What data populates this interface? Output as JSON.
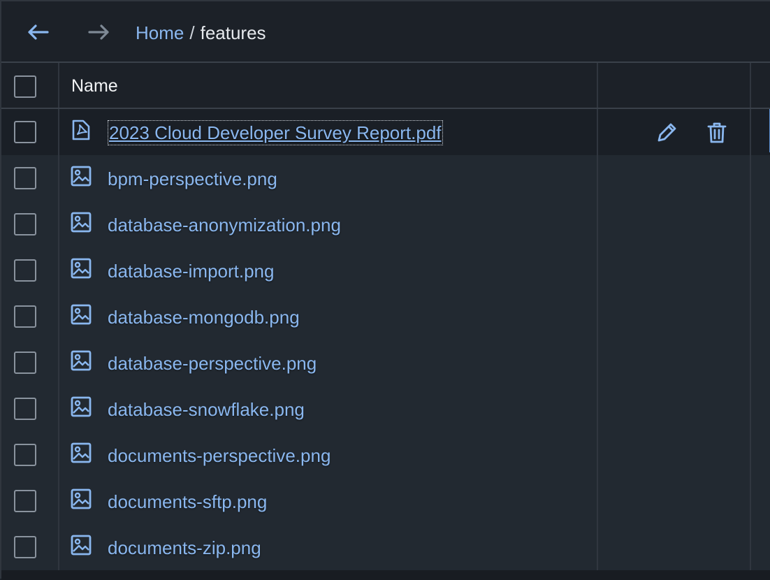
{
  "toolbar": {
    "back_icon": "arrow-left-icon",
    "forward_icon": "arrow-right-icon",
    "breadcrumb": {
      "home": "Home",
      "separator": "/",
      "current": "features"
    }
  },
  "table": {
    "columns": {
      "name": "Name"
    },
    "rows": [
      {
        "name": "2023 Cloud Developer Survey Report.pdf",
        "icon": "pdf-file-icon"
      },
      {
        "name": "bpm-perspective.png",
        "icon": "image-file-icon"
      },
      {
        "name": "database-anonymization.png",
        "icon": "image-file-icon"
      },
      {
        "name": "database-import.png",
        "icon": "image-file-icon"
      },
      {
        "name": "database-mongodb.png",
        "icon": "image-file-icon"
      },
      {
        "name": "database-perspective.png",
        "icon": "image-file-icon"
      },
      {
        "name": "database-snowflake.png",
        "icon": "image-file-icon"
      },
      {
        "name": "documents-perspective.png",
        "icon": "image-file-icon"
      },
      {
        "name": "documents-sftp.png",
        "icon": "image-file-icon"
      },
      {
        "name": "documents-zip.png",
        "icon": "image-file-icon"
      }
    ],
    "row_actions": {
      "edit_icon": "pencil-icon",
      "delete_icon": "trash-icon"
    }
  },
  "colors": {
    "link": "#8ab7ef",
    "background": "#222931",
    "header": "#1c2128"
  }
}
